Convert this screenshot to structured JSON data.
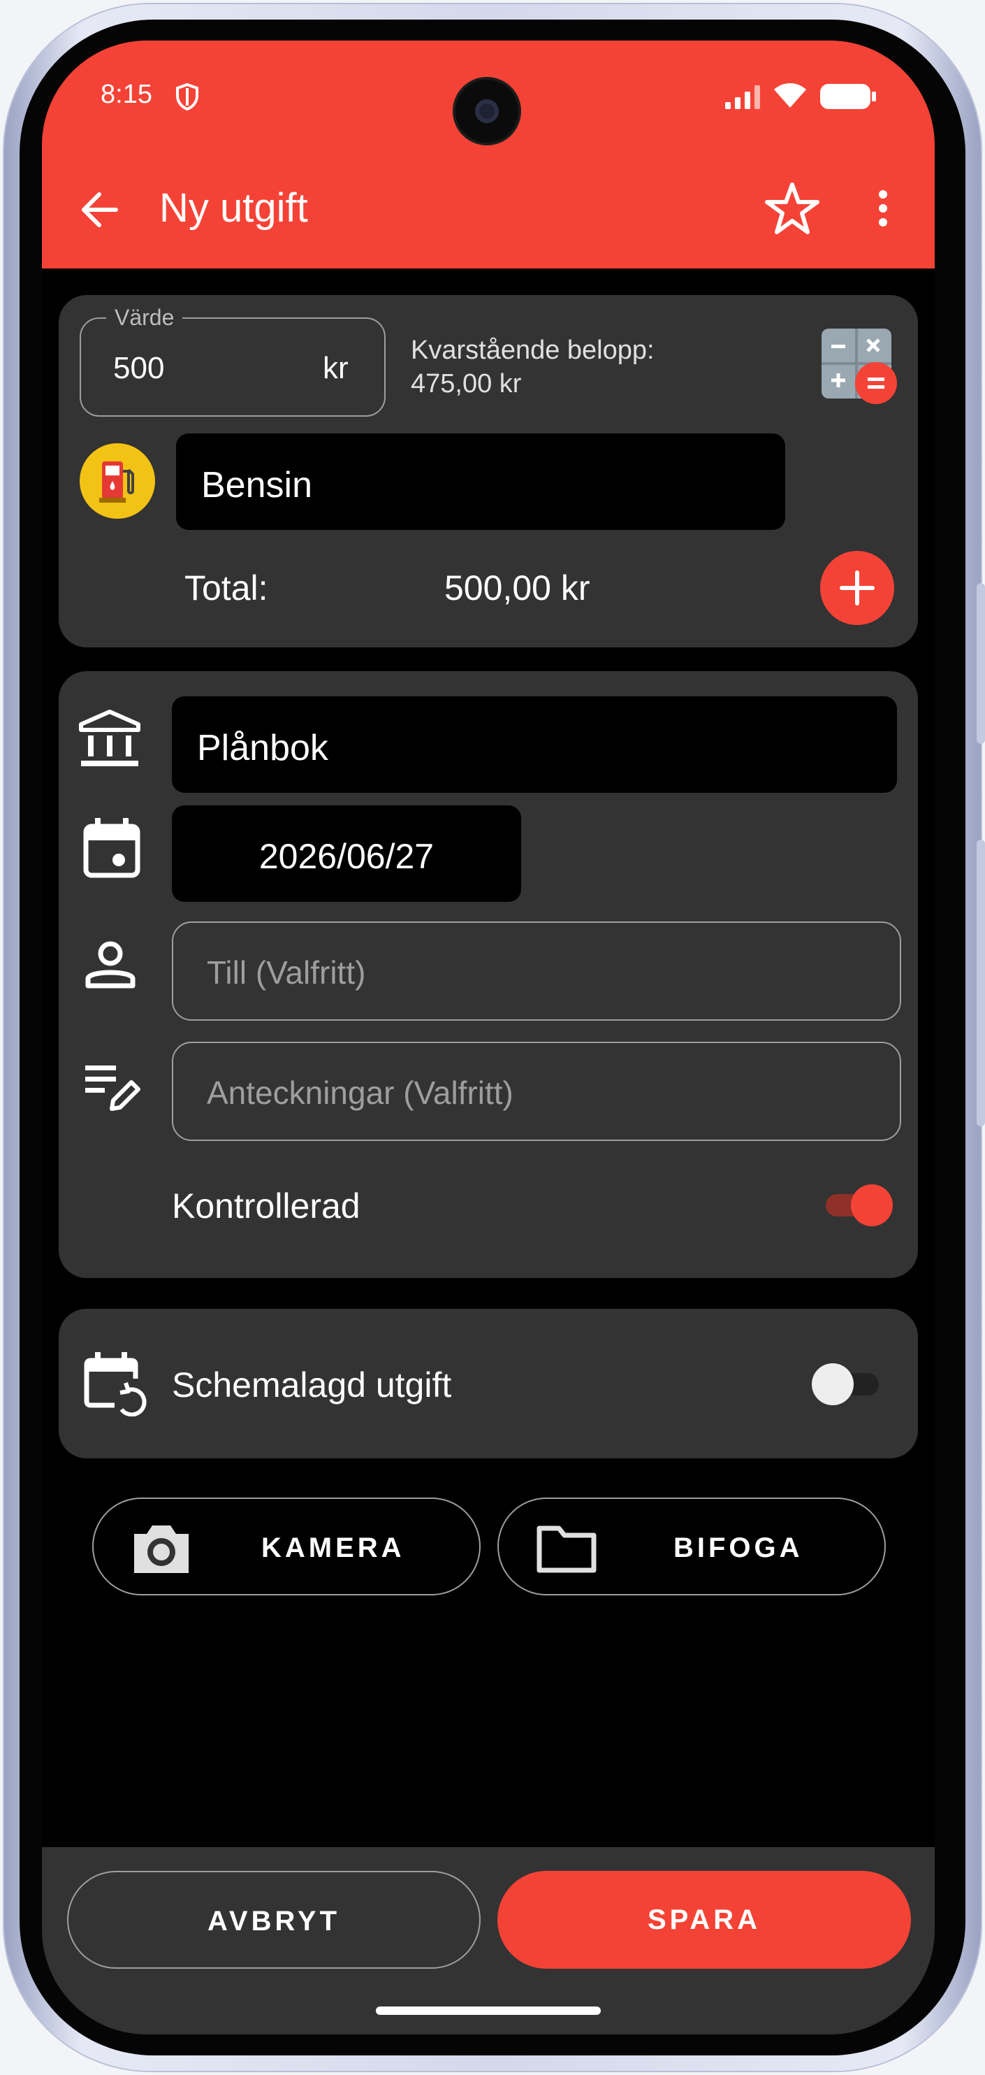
{
  "status_bar": {
    "time": "8:15"
  },
  "toolbar": {
    "title": "Ny utgift"
  },
  "amount_card": {
    "value_label": "Värde",
    "value": "500",
    "currency": "kr",
    "remaining_label": "Kvarstående belopp:",
    "remaining_value": "475,00 kr",
    "category": "Bensin",
    "total_label": "Total:",
    "total_value": "500,00 kr"
  },
  "details_card": {
    "account": "Plånbok",
    "date": "2026/06/27",
    "payee_placeholder": "Till (Valfritt)",
    "notes_placeholder": "Anteckningar (Valfritt)",
    "checked_label": "Kontrollerad",
    "checked_on": true
  },
  "schedule_card": {
    "label": "Schemalagd utgift",
    "enabled": false
  },
  "attachments": {
    "camera_label": "KAMERA",
    "attach_label": "BIFOGA"
  },
  "bottom_bar": {
    "cancel_label": "AVBRYT",
    "save_label": "SPARA"
  },
  "colors": {
    "accent": "#f44336",
    "card": "#333333",
    "category_icon_bg": "#f2c315"
  },
  "icons": {
    "toolbar": [
      "back-arrow-icon",
      "star-outline-icon",
      "more-vert-icon"
    ],
    "status": [
      "shield-icon",
      "signal-icon",
      "wifi-icon",
      "battery-icon"
    ],
    "fields": [
      "calculator-icon",
      "fuel-pump-icon",
      "add-icon",
      "bank-icon",
      "calendar-icon",
      "person-icon",
      "notes-edit-icon",
      "calendar-repeat-icon",
      "camera-icon",
      "folder-icon"
    ]
  }
}
